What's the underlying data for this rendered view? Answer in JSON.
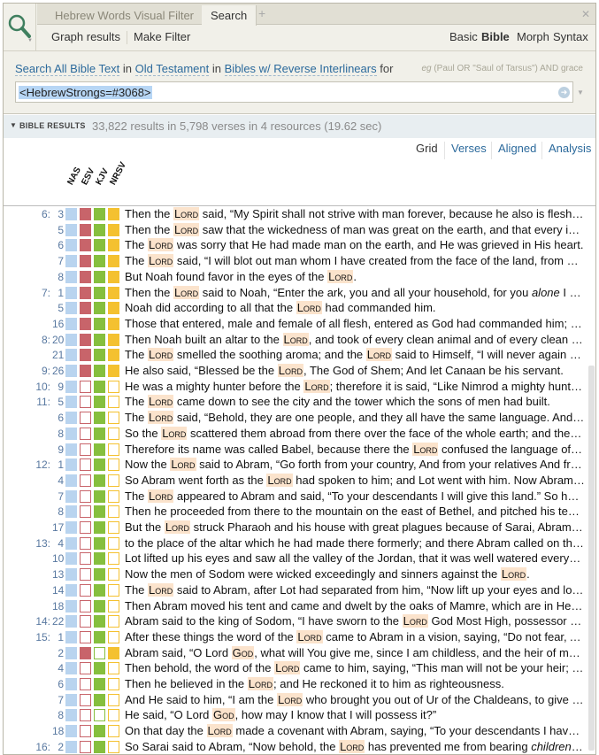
{
  "tabs": [
    {
      "label": "Hebrew Words Visual Filter"
    },
    {
      "label": "Search"
    }
  ],
  "toolbar": {
    "graph": "Graph results",
    "filter": "Make Filter",
    "modes": [
      "Basic",
      "Bible",
      "Morph",
      "Syntax"
    ],
    "selected_mode": "Bible"
  },
  "scope": {
    "search": "Search",
    "what": "All Bible Text",
    "in1": "in",
    "range": "Old Testament",
    "in2": "in",
    "collection": "Bibles w/ Reverse Interlinears",
    "for": "for",
    "example_eg": "eg",
    "example": "(Paul OR \"Saul of Tarsus\") AND grace"
  },
  "query": {
    "value": "<HebrewStrongs=#3068>"
  },
  "results": {
    "title": "BIBLE RESULTS",
    "summary": "33,822 results in 5,798 verses in 4 resources (19.62 sec)"
  },
  "views": [
    "Grid",
    "Verses",
    "Aligned",
    "Analysis"
  ],
  "columns": [
    "NAS",
    "ESV",
    "KJV",
    "NRSV"
  ],
  "colors": {
    "NAS": "#b9d4ef",
    "ESV": "#c8646a",
    "KJV": "#86bf3e",
    "NRSV": "#f4c130",
    "highlight": "#fbe3cc"
  },
  "rows": [
    {
      "ch": "6:",
      "v": "3",
      "f": "1111",
      "t": [
        "Then the ",
        {
          "h": "Lord"
        },
        " said, “My Spirit shall not strive with man forever, because he also is flesh; ne..."
      ]
    },
    {
      "ch": "",
      "v": "5",
      "f": "1111",
      "t": [
        "Then the ",
        {
          "h": "Lord"
        },
        " saw that the wickedness of man was great on the earth, and that every inte..."
      ]
    },
    {
      "ch": "",
      "v": "6",
      "f": "1111",
      "t": [
        "The ",
        {
          "h": "Lord"
        },
        " was sorry that He had made man on the earth, and He was grieved in His heart."
      ]
    },
    {
      "ch": "",
      "v": "7",
      "f": "1111",
      "t": [
        "The ",
        {
          "h": "Lord"
        },
        " said, “I will blot out man whom I have created from the face of the land, from ma..."
      ]
    },
    {
      "ch": "",
      "v": "8",
      "f": "1111",
      "t": [
        "But Noah found favor in the eyes of the ",
        {
          "h": "Lord"
        },
        "."
      ]
    },
    {
      "ch": "7:",
      "v": "1",
      "f": "1111",
      "t": [
        " Then the ",
        {
          "h": "Lord"
        },
        " said to Noah, “Enter the ark, you and all your household, for you ",
        {
          "i": "alone"
        },
        " I hav..."
      ]
    },
    {
      "ch": "",
      "v": "5",
      "f": "1111",
      "t": [
        "Noah did according to all that the ",
        {
          "h": "Lord"
        },
        " had commanded him."
      ]
    },
    {
      "ch": "",
      "v": "16",
      "f": "1111",
      "t": [
        "Those that entered, male and female of all flesh, entered as God had commanded him; and..."
      ]
    },
    {
      "ch": "8:",
      "v": "20",
      "f": "1111",
      "t": [
        "Then Noah built an altar to the ",
        {
          "h": "Lord"
        },
        ", and took of every clean animal and of every clean bir..."
      ]
    },
    {
      "ch": "",
      "v": "21",
      "f": "1111",
      "t": [
        "The ",
        {
          "h": "Lord"
        },
        " smelled the soothing aroma; and the ",
        {
          "h": "Lord"
        },
        " said to Himself, “I will never again curs..."
      ]
    },
    {
      "ch": "9:",
      "v": "26",
      "f": "1111",
      "t": [
        "He also said, “Blessed be the ",
        {
          "h": "Lord"
        },
        ", The God of Shem; And let Canaan be his servant."
      ]
    },
    {
      "ch": "10:",
      "v": "9",
      "f": "1010",
      "t": [
        "He was a mighty hunter before the ",
        {
          "h": "Lord"
        },
        "; therefore it is said, “Like Nimrod a mighty hunter..."
      ]
    },
    {
      "ch": "11:",
      "v": "5",
      "f": "1010",
      "t": [
        "The ",
        {
          "h": "Lord"
        },
        " came down to see the city and the tower which the sons of men had built."
      ]
    },
    {
      "ch": "",
      "v": "6",
      "f": "1010",
      "t": [
        "The ",
        {
          "h": "Lord"
        },
        " said, “Behold, they are one people, and they all have the same language. And this..."
      ]
    },
    {
      "ch": "",
      "v": "8",
      "f": "1010",
      "t": [
        "So the ",
        {
          "h": "Lord"
        },
        " scattered them abroad from there over the face of the whole earth; and they s..."
      ]
    },
    {
      "ch": "",
      "v": "9",
      "f": "1010",
      "t": [
        "Therefore its name was called Babel, because there the ",
        {
          "h": "Lord"
        },
        " confused the language of the..."
      ]
    },
    {
      "ch": "12:",
      "v": "1",
      "f": "1010",
      "t": [
        " Now the ",
        {
          "h": "Lord"
        },
        " said to Abram, “Go forth from your country, And from your relatives And fro..."
      ]
    },
    {
      "ch": "",
      "v": "4",
      "f": "1010",
      "t": [
        "So Abram went forth as the ",
        {
          "h": "Lord"
        },
        " had spoken to him; and Lot went with him. Now Abram w..."
      ]
    },
    {
      "ch": "",
      "v": "7",
      "f": "1010",
      "t": [
        "The ",
        {
          "h": "Lord"
        },
        " appeared to Abram and said, “To your descendants I will give this land.” So he buil..."
      ]
    },
    {
      "ch": "",
      "v": "8",
      "f": "1010",
      "t": [
        "Then he proceeded from there to the mountain on the east of Bethel, and pitched his tent,..."
      ]
    },
    {
      "ch": "",
      "v": "17",
      "f": "1010",
      "t": [
        "But the ",
        {
          "h": "Lord"
        },
        " struck Pharaoh and his house with great plagues because of Sarai, Abram’s wi..."
      ]
    },
    {
      "ch": "13:",
      "v": "4",
      "f": "1010",
      "t": [
        "to the place of the altar which he had made there formerly; and there Abram called on the..."
      ]
    },
    {
      "ch": "",
      "v": "10",
      "f": "1010",
      "t": [
        "Lot lifted up his eyes and saw all the valley of the Jordan, that it was well watered everywh..."
      ]
    },
    {
      "ch": "",
      "v": "13",
      "f": "1010",
      "t": [
        "Now the men of Sodom were wicked exceedingly and sinners against the ",
        {
          "h": "Lord"
        },
        "."
      ]
    },
    {
      "ch": "",
      "v": "14",
      "f": "1010",
      "t": [
        "The ",
        {
          "h": "Lord"
        },
        " said to Abram, after Lot had separated from him, “Now lift up your eyes and look..."
      ]
    },
    {
      "ch": "",
      "v": "18",
      "f": "1010",
      "t": [
        "Then Abram moved his tent and came and dwelt by the oaks of Mamre, which are in Hebro..."
      ]
    },
    {
      "ch": "14:",
      "v": "22",
      "f": "1010",
      "t": [
        "Abram said to the king of Sodom, “I have sworn to the ",
        {
          "h": "Lord"
        },
        " God Most High, possessor of he..."
      ]
    },
    {
      "ch": "15:",
      "v": "1",
      "f": "1010",
      "t": [
        " After these things the word of the ",
        {
          "h": "Lord"
        },
        " came to Abram in a vision, saying, “Do not fear, Ab..."
      ]
    },
    {
      "ch": "",
      "v": "2",
      "f": "1101",
      "t": [
        "Abram said, “O Lord ",
        {
          "h": "God"
        },
        ", what will You give me, since I am childless, and the heir of my hou..."
      ]
    },
    {
      "ch": "",
      "v": "4",
      "f": "1010",
      "t": [
        "Then behold, the word of the ",
        {
          "h": "Lord"
        },
        " came to him, saying, “This man will not be your heir; but..."
      ]
    },
    {
      "ch": "",
      "v": "6",
      "f": "1010",
      "t": [
        "Then he believed in the ",
        {
          "h": "Lord"
        },
        "; and He reckoned it to him as righteousness."
      ]
    },
    {
      "ch": "",
      "v": "7",
      "f": "1010",
      "t": [
        "And He said to him, “I am the ",
        {
          "h": "Lord"
        },
        " who brought you out of Ur of the Chaldeans, to give you..."
      ]
    },
    {
      "ch": "",
      "v": "8",
      "f": "1000",
      "t": [
        "He said, “O Lord ",
        {
          "h": "God"
        },
        ", how may I know that I will possess it?”"
      ]
    },
    {
      "ch": "",
      "v": "18",
      "f": "1010",
      "t": [
        "On that day the ",
        {
          "h": "Lord"
        },
        " made a covenant with Abram, saying, “To your descendants I have giv..."
      ]
    },
    {
      "ch": "16:",
      "v": "2",
      "f": "1010",
      "t": [
        "So Sarai said to Abram, “Now behold, the ",
        {
          "h": "Lord"
        },
        " has prevented me from bearing ",
        {
          "i": "children"
        },
        ". Ple..."
      ]
    }
  ]
}
